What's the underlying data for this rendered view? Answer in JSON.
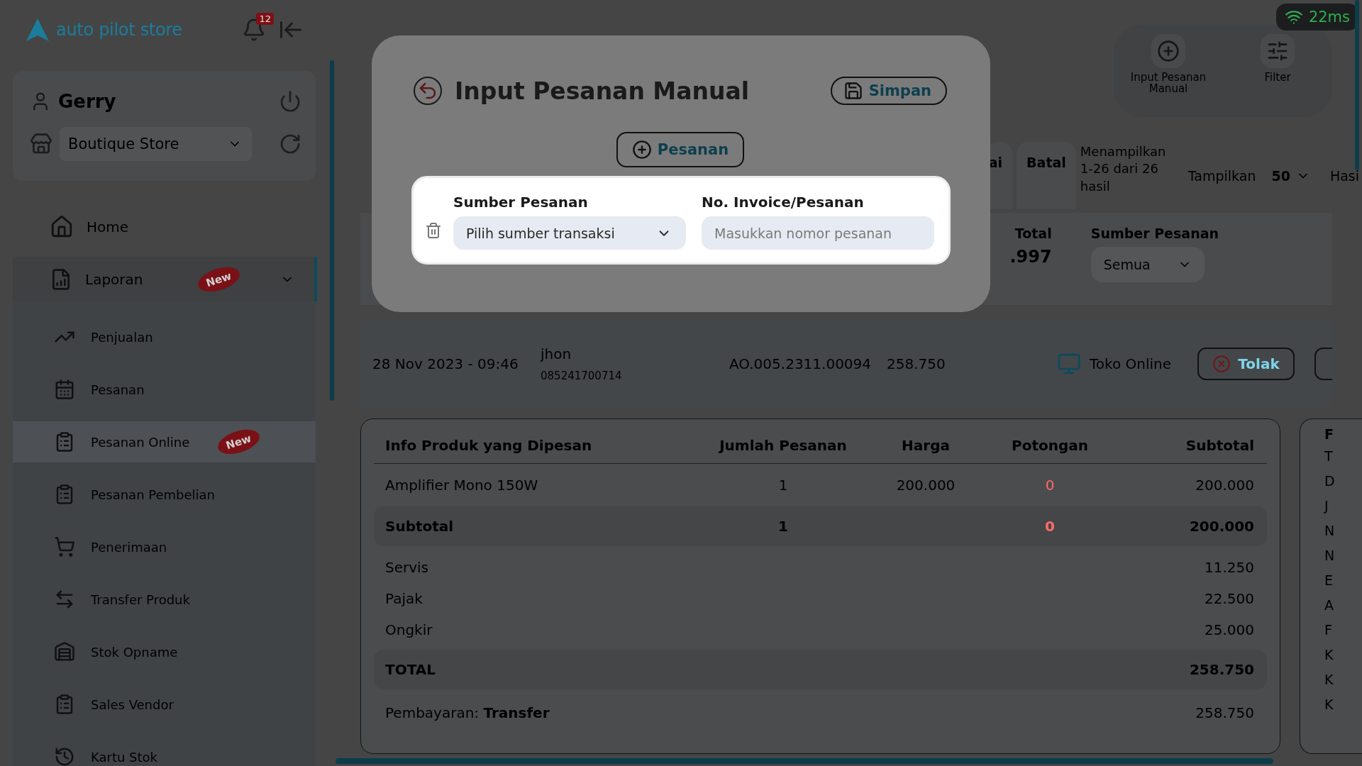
{
  "sidebar": {
    "logo": "auto pilot store",
    "notification_count": "12",
    "user": {
      "name": "Gerry"
    },
    "store_select": {
      "value": "Boutique Store"
    },
    "menu": [
      {
        "label": "Home",
        "selected": false
      },
      {
        "label": "Laporan",
        "selected": true,
        "expanded": true,
        "badge": "New",
        "children": [
          {
            "label": "Penjualan",
            "selected": false
          },
          {
            "label": "Pesanan",
            "selected": false
          },
          {
            "label": "Pesanan Online",
            "selected": true,
            "badge": "New"
          },
          {
            "label": "Pesanan Pembelian",
            "selected": false
          },
          {
            "label": "Penerimaan",
            "selected": false
          },
          {
            "label": "Transfer Produk",
            "selected": false
          },
          {
            "label": "Stok Opname",
            "selected": false
          },
          {
            "label": "Sales Vendor",
            "selected": false
          },
          {
            "label": "Kartu Stok",
            "selected": false
          }
        ]
      }
    ]
  },
  "connection": {
    "latency": "22ms"
  },
  "toolbar": {
    "actions": [
      {
        "label": "Input Pesanan Manual"
      },
      {
        "label": "Filter"
      }
    ]
  },
  "status_tabs": [
    {
      "label": "ai",
      "selected": false
    },
    {
      "label": "Batal",
      "selected": false
    }
  ],
  "result_count": "Menampilkan 1-26 dari 26 hasil",
  "page_size": {
    "label": "Tampilkan",
    "value": "50"
  },
  "cut_heading": "Hasi",
  "summary": {
    "total_label": "Total",
    "total_value": ".997",
    "source_filter": {
      "label": "Sumber Pesanan",
      "value": "Semua"
    }
  },
  "order": {
    "date": "28 Nov 2023 - 09:46",
    "customer": "jhon",
    "phone": "085241700714",
    "invoice": "AO.005.2311.00094",
    "amount": "258.750",
    "source": "Toko Online",
    "reject_button": "Tolak"
  },
  "order_details": {
    "columns": [
      "Info Produk yang Dipesan",
      "Jumlah Pesanan",
      "Harga",
      "Potongan",
      "Subtotal"
    ],
    "items": [
      {
        "name": "Amplifier Mono 150W",
        "qty": "1",
        "price": "200.000",
        "discount": "0",
        "subtotal": "200.000"
      }
    ],
    "subtotal_row": {
      "label": "Subtotal",
      "qty": "1",
      "discount": "0",
      "subtotal": "200.000"
    },
    "charges": [
      {
        "label": "Servis",
        "value": "11.250"
      },
      {
        "label": "Pajak",
        "value": "22.500"
      },
      {
        "label": "Ongkir",
        "value": "25.000"
      }
    ],
    "total": {
      "label": "TOTAL",
      "value": "258.750"
    },
    "payment": {
      "text": "Pembayaran: **Transfer**",
      "value": "258.750"
    }
  },
  "side_panel": {
    "heading": "F",
    "lines": [
      "T",
      "D",
      "J",
      "N",
      "N",
      "E",
      "A",
      "F",
      "K",
      "K",
      "K"
    ]
  },
  "modal": {
    "title": "Input Pesanan Manual",
    "save_button": "Simpan",
    "add_button": "Pesanan",
    "entries": [
      {
        "source_label": "Sumber Pesanan",
        "source_value": "Pilih sumber transaksi",
        "invoice_label": "No. Invoice/Pesanan",
        "invoice_placeholder": "Masukkan nomor pesanan"
      }
    ]
  }
}
